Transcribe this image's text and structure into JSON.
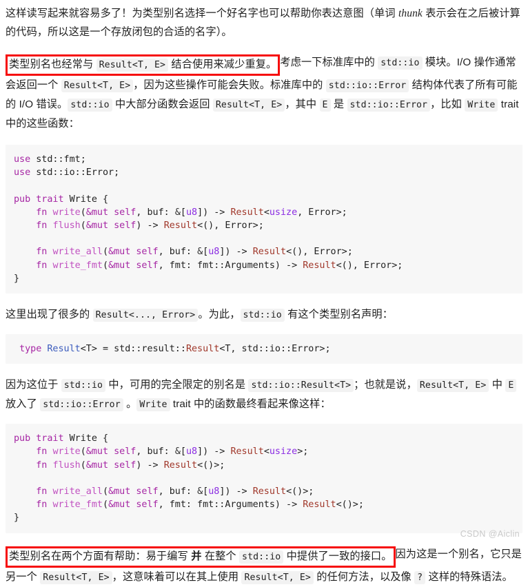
{
  "document": {
    "watermark": "CSDN @Aiclin",
    "accent_highlight_color": "#f60b0b",
    "inline_code_bg": "#f2f2f2",
    "code_block_bg": "#f7f7f7"
  },
  "paragraphs": {
    "p1": {
      "seg1": "这样读写起来就容易多了！为类型别名选择一个好名字也可以帮助你表达意图（单词 ",
      "italic": "thunk",
      "seg2": " 表示会在之后被计算的代码，所以这是一个存放闭包的合适的名字）。"
    },
    "p2": {
      "hl_seg1": "类型别名也经常与 ",
      "hl_code": "Result<T, E>",
      "hl_seg2": " 结合使用来减少重复。",
      "seg3": "考虑一下标准库中的 ",
      "code1": "std::io",
      "seg4": " 模块。I/O 操作通常会返回一个 ",
      "code2": "Result<T, E>",
      "seg5": "，因为这些操作可能会失败。标准库中的 ",
      "code3": "std::io::Error",
      "seg6": " 结构体代表了所有可能的 I/O 错误。",
      "code4": "std::io",
      "seg7": " 中大部分函数会返回 ",
      "code5": "Result<T, E>",
      "seg8": "，其中 ",
      "code6": "E",
      "seg9": " 是 ",
      "code7": "std::io::Error",
      "seg10": "，比如 ",
      "code8": "Write",
      "seg11": " trait 中的这些函数："
    },
    "p3": {
      "seg1": "这里出现了很多的 ",
      "code1": "Result<..., Error>",
      "seg2": "。为此，",
      "code2": "std::io",
      "seg3": " 有这个类型别名声明："
    },
    "p4": {
      "seg1": "因为这位于 ",
      "code1": "std::io",
      "seg2": " 中，可用的完全限定的别名是 ",
      "code2": "std::io::Result<T>",
      "seg3": "；也就是说，",
      "code3": "Result<T, E>",
      "seg4": " 中 ",
      "code4": "E",
      "seg5": " 放入了 ",
      "code5": "std::io::Error",
      "seg6": " 。",
      "code6": "Write",
      "seg7": " trait 中的函数最终看起来像这样："
    },
    "p5": {
      "hl_seg1": "类型别名在两个方面有帮助：易于编写 ",
      "hl_bold": "并",
      "hl_seg2": " 在整个 ",
      "hl_code": "std::io",
      "hl_seg3": " 中提供了一致的接口。",
      "seg4": "因为这是一个别名，它只是另一个 ",
      "code1": "Result<T, E>",
      "seg5": "，这意味着可以在其上使用 ",
      "code2": "Result<T, E>",
      "seg6": " 的任何方法，以及像 ",
      "code3": "?",
      "seg7": " 这样的特殊语法。"
    }
  },
  "code_blocks": {
    "block1": {
      "language": "rust",
      "lines": [
        "use std::fmt;",
        "use std::io::Error;",
        "",
        "pub trait Write {",
        "    fn write(&mut self, buf: &[u8]) -> Result<usize, Error>;",
        "    fn flush(&mut self) -> Result<(), Error>;",
        "",
        "    fn write_all(&mut self, buf: &[u8]) -> Result<(), Error>;",
        "    fn write_fmt(&mut self, fmt: fmt::Arguments) -> Result<(), Error>;",
        "}"
      ]
    },
    "block2": {
      "language": "rust",
      "lines": [
        "type Result<T> = std::result::Result<T, std::io::Error>;"
      ]
    },
    "block3": {
      "language": "rust",
      "lines": [
        "pub trait Write {",
        "    fn write(&mut self, buf: &[u8]) -> Result<usize>;",
        "    fn flush(&mut self) -> Result<()>;",
        "",
        "    fn write_all(&mut self, buf: &[u8]) -> Result<()>;",
        "    fn write_fmt(&mut self, fmt: fmt::Arguments) -> Result<()>;",
        "}"
      ]
    }
  }
}
